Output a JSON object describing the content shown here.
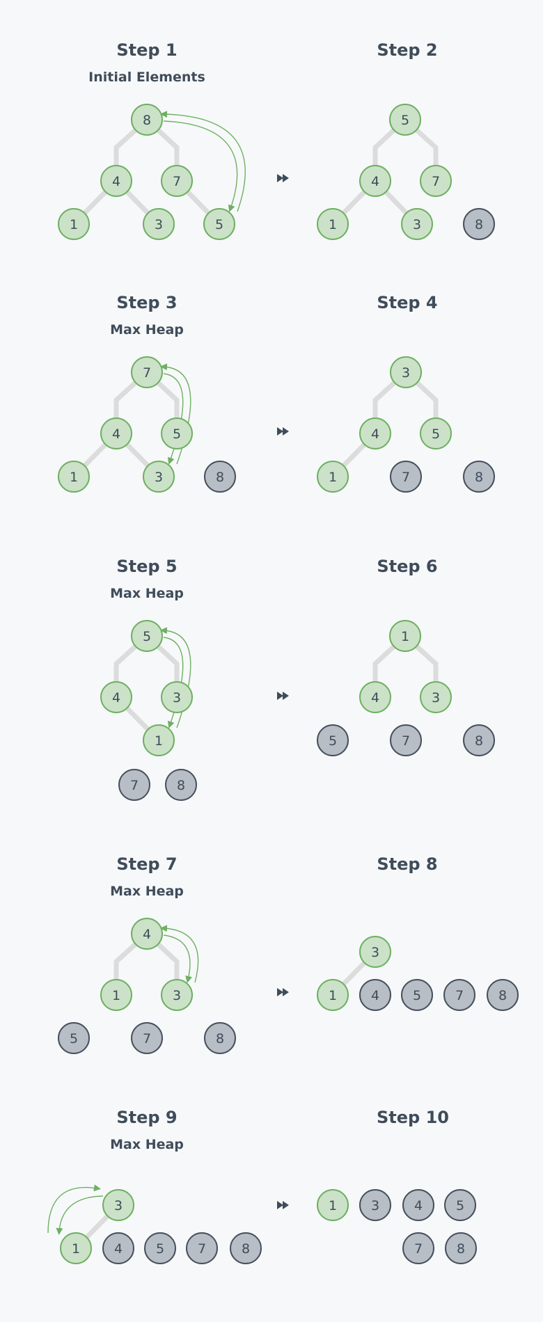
{
  "diagram": "heap-sort-steps",
  "colors": {
    "background": "#f7f8fa",
    "active_fill": "#cce2c8",
    "active_stroke": "#6db061",
    "sorted_fill": "#b8bec6",
    "sorted_stroke": "#46505c",
    "edge": "#dcdcdc",
    "text": "#3f4c5a",
    "swap_arrow": "#6db061"
  },
  "next_icon": "fast-forward-icon",
  "steps": [
    {
      "title": "Step 1",
      "subtitle": "Initial Elements",
      "nodes": [
        {
          "id": "a",
          "value": "8",
          "state": "active"
        },
        {
          "id": "b",
          "value": "4",
          "state": "active"
        },
        {
          "id": "c",
          "value": "7",
          "state": "active"
        },
        {
          "id": "d",
          "value": "1",
          "state": "active"
        },
        {
          "id": "e",
          "value": "3",
          "state": "active"
        },
        {
          "id": "f",
          "value": "5",
          "state": "active"
        }
      ],
      "edges": [
        [
          "a",
          "b"
        ],
        [
          "a",
          "c"
        ],
        [
          "b",
          "d"
        ],
        [
          "b",
          "e"
        ],
        [
          "c",
          "f"
        ]
      ],
      "swap": [
        "a",
        "f"
      ]
    },
    {
      "title": "Step 2",
      "subtitle": "",
      "nodes": [
        {
          "id": "a",
          "value": "5",
          "state": "active"
        },
        {
          "id": "b",
          "value": "4",
          "state": "active"
        },
        {
          "id": "c",
          "value": "7",
          "state": "active"
        },
        {
          "id": "d",
          "value": "1",
          "state": "active"
        },
        {
          "id": "e",
          "value": "3",
          "state": "active"
        },
        {
          "id": "f",
          "value": "8",
          "state": "sorted"
        }
      ],
      "edges": [
        [
          "a",
          "b"
        ],
        [
          "a",
          "c"
        ],
        [
          "b",
          "d"
        ],
        [
          "b",
          "e"
        ]
      ],
      "swap": null
    },
    {
      "title": "Step 3",
      "subtitle": "Max Heap",
      "nodes": [
        {
          "id": "a",
          "value": "7",
          "state": "active"
        },
        {
          "id": "b",
          "value": "4",
          "state": "active"
        },
        {
          "id": "c",
          "value": "5",
          "state": "active"
        },
        {
          "id": "d",
          "value": "1",
          "state": "active"
        },
        {
          "id": "e",
          "value": "3",
          "state": "active"
        },
        {
          "id": "f",
          "value": "8",
          "state": "sorted"
        }
      ],
      "edges": [
        [
          "a",
          "b"
        ],
        [
          "a",
          "c"
        ],
        [
          "b",
          "d"
        ],
        [
          "b",
          "e"
        ]
      ],
      "swap": [
        "a",
        "e"
      ]
    },
    {
      "title": "Step 4",
      "subtitle": "",
      "nodes": [
        {
          "id": "a",
          "value": "3",
          "state": "active"
        },
        {
          "id": "b",
          "value": "4",
          "state": "active"
        },
        {
          "id": "c",
          "value": "5",
          "state": "active"
        },
        {
          "id": "d",
          "value": "1",
          "state": "active"
        },
        {
          "id": "e",
          "value": "7",
          "state": "sorted"
        },
        {
          "id": "f",
          "value": "8",
          "state": "sorted"
        }
      ],
      "edges": [
        [
          "a",
          "b"
        ],
        [
          "a",
          "c"
        ],
        [
          "b",
          "d"
        ]
      ],
      "swap": null
    },
    {
      "title": "Step 5",
      "subtitle": "Max Heap",
      "nodes": [
        {
          "id": "a",
          "value": "5",
          "state": "active"
        },
        {
          "id": "b",
          "value": "4",
          "state": "active"
        },
        {
          "id": "c",
          "value": "3",
          "state": "active"
        },
        {
          "id": "d",
          "value": "1",
          "state": "active"
        },
        {
          "id": "e",
          "value": "7",
          "state": "sorted"
        },
        {
          "id": "f",
          "value": "8",
          "state": "sorted"
        }
      ],
      "edges": [
        [
          "a",
          "b"
        ],
        [
          "a",
          "c"
        ],
        [
          "b",
          "d"
        ]
      ],
      "swap": [
        "a",
        "d"
      ]
    },
    {
      "title": "Step 6",
      "subtitle": "",
      "nodes": [
        {
          "id": "a",
          "value": "1",
          "state": "active"
        },
        {
          "id": "b",
          "value": "4",
          "state": "active"
        },
        {
          "id": "c",
          "value": "3",
          "state": "active"
        },
        {
          "id": "d",
          "value": "5",
          "state": "sorted"
        },
        {
          "id": "e",
          "value": "7",
          "state": "sorted"
        },
        {
          "id": "f",
          "value": "8",
          "state": "sorted"
        }
      ],
      "edges": [
        [
          "a",
          "b"
        ],
        [
          "a",
          "c"
        ]
      ],
      "swap": null
    },
    {
      "title": "Step 7",
      "subtitle": "Max Heap",
      "nodes": [
        {
          "id": "a",
          "value": "4",
          "state": "active"
        },
        {
          "id": "b",
          "value": "1",
          "state": "active"
        },
        {
          "id": "c",
          "value": "3",
          "state": "active"
        },
        {
          "id": "d",
          "value": "5",
          "state": "sorted"
        },
        {
          "id": "e",
          "value": "7",
          "state": "sorted"
        },
        {
          "id": "f",
          "value": "8",
          "state": "sorted"
        }
      ],
      "edges": [
        [
          "a",
          "b"
        ],
        [
          "a",
          "c"
        ]
      ],
      "swap": [
        "a",
        "c"
      ]
    },
    {
      "title": "Step 8",
      "subtitle": "",
      "nodes": [
        {
          "id": "a",
          "value": "3",
          "state": "active"
        },
        {
          "id": "b",
          "value": "1",
          "state": "active"
        },
        {
          "id": "c",
          "value": "4",
          "state": "sorted"
        },
        {
          "id": "d",
          "value": "5",
          "state": "sorted"
        },
        {
          "id": "e",
          "value": "7",
          "state": "sorted"
        },
        {
          "id": "f",
          "value": "8",
          "state": "sorted"
        }
      ],
      "edges": [
        [
          "a",
          "b"
        ]
      ],
      "swap": null
    },
    {
      "title": "Step 9",
      "subtitle": "Max Heap",
      "nodes": [
        {
          "id": "a",
          "value": "3",
          "state": "active"
        },
        {
          "id": "b",
          "value": "1",
          "state": "active"
        },
        {
          "id": "c",
          "value": "4",
          "state": "sorted"
        },
        {
          "id": "d",
          "value": "5",
          "state": "sorted"
        },
        {
          "id": "e",
          "value": "7",
          "state": "sorted"
        },
        {
          "id": "f",
          "value": "8",
          "state": "sorted"
        }
      ],
      "edges": [
        [
          "a",
          "b"
        ]
      ],
      "swap": [
        "a",
        "b"
      ]
    },
    {
      "title": "Step 10",
      "subtitle": "",
      "nodes": [
        {
          "id": "a",
          "value": "1",
          "state": "active"
        },
        {
          "id": "b",
          "value": "3",
          "state": "sorted"
        },
        {
          "id": "c",
          "value": "4",
          "state": "sorted"
        },
        {
          "id": "d",
          "value": "5",
          "state": "sorted"
        },
        {
          "id": "e",
          "value": "7",
          "state": "sorted"
        },
        {
          "id": "f",
          "value": "8",
          "state": "sorted"
        }
      ],
      "edges": [],
      "swap": null
    }
  ]
}
